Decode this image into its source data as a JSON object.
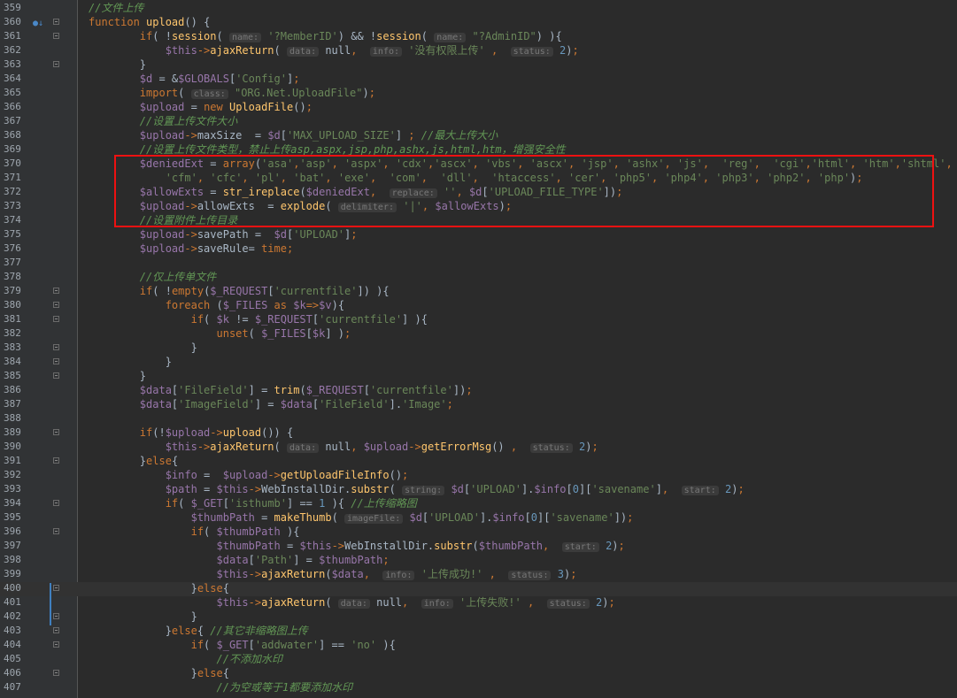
{
  "editor": {
    "language": "php",
    "colors": {
      "background": "#2b2b2b",
      "keyword": "#cc7832",
      "function": "#ffc66d",
      "variable": "#9876aa",
      "string": "#6a8759",
      "comment": "#629755",
      "highlight_box": "#ee1111"
    },
    "gutter_icons": [
      "bookmark-icon",
      "fold-icon"
    ],
    "lines": [
      {
        "n": "359",
        "t": "    //文件上传"
      },
      {
        "n": "360",
        "t": "    function upload() {"
      },
      {
        "n": "361",
        "t": "            if( !session( name: '?MemberID') && !session( name: \"?AdminID\") ){"
      },
      {
        "n": "362",
        "t": "                $this->ajaxReturn( data: null,  info: '没有权限上传' ,  status: 2);"
      },
      {
        "n": "363",
        "t": "            }"
      },
      {
        "n": "364",
        "t": "            $d = &$GLOBALS['Config'];"
      },
      {
        "n": "365",
        "t": "            import( class: \"ORG.Net.UploadFile\");"
      },
      {
        "n": "366",
        "t": "            $upload = new UploadFile();"
      },
      {
        "n": "367",
        "t": "            //设置上传文件大小"
      },
      {
        "n": "368",
        "t": "            $upload->maxSize  = $d['MAX_UPLOAD_SIZE'] ; //最大上传大小"
      },
      {
        "n": "369",
        "t": "            //设置上传文件类型，禁止上传asp,aspx,jsp,php,ashx,js,html,htm，增强安全性"
      },
      {
        "n": "370",
        "t": "            $deniedExt = array('asa','asp', 'aspx', 'cdx','ascx', 'vbs', 'ascx', 'jsp', 'ashx', 'js',  'reg',  'cgi','html', 'htm','shtml',"
      },
      {
        "n": "371",
        "t": "                'cfm', 'cfc', 'pl', 'bat', 'exe',  'com',  'dll',  'htaccess', 'cer', 'php5', 'php4', 'php3', 'php2', 'php');"
      },
      {
        "n": "372",
        "t": "            $allowExts = str_ireplace($deniedExt,  replace: '', $d['UPLOAD_FILE_TYPE']);"
      },
      {
        "n": "373",
        "t": "            $upload->allowExts  = explode( delimiter: '|', $allowExts);"
      },
      {
        "n": "374",
        "t": "            //设置附件上传目录"
      },
      {
        "n": "375",
        "t": "            $upload->savePath =  $d['UPLOAD'];"
      },
      {
        "n": "376",
        "t": "            $upload->saveRule= time;"
      },
      {
        "n": "377",
        "t": ""
      },
      {
        "n": "378",
        "t": "            //仅上传单文件"
      },
      {
        "n": "379",
        "t": "            if( !empty($_REQUEST['currentfile']) ){"
      },
      {
        "n": "380",
        "t": "                foreach ($_FILES as $k=>$v){"
      },
      {
        "n": "381",
        "t": "                    if( $k != $_REQUEST['currentfile'] ){"
      },
      {
        "n": "382",
        "t": "                        unset( $_FILES[$k] );"
      },
      {
        "n": "383",
        "t": "                    }"
      },
      {
        "n": "384",
        "t": "                }"
      },
      {
        "n": "385",
        "t": "            }"
      },
      {
        "n": "386",
        "t": "            $data['FileField'] = trim($_REQUEST['currentfile']);"
      },
      {
        "n": "387",
        "t": "            $data['ImageField'] = $data['FileField'].'Image';"
      },
      {
        "n": "388",
        "t": ""
      },
      {
        "n": "389",
        "t": "            if(!$upload->upload()) {"
      },
      {
        "n": "390",
        "t": "                $this->ajaxReturn( data: null, $upload->getErrorMsg() ,  status: 2);"
      },
      {
        "n": "391",
        "t": "            }else{"
      },
      {
        "n": "392",
        "t": "                $info =  $upload->getUploadFileInfo();"
      },
      {
        "n": "393",
        "t": "                $path = $this->WebInstallDir.substr( string: $d['UPLOAD'].$info[0]['savename'],  start: 2);"
      },
      {
        "n": "394",
        "t": "                if( $_GET['isthumb'] == 1 ){ //上传缩略图"
      },
      {
        "n": "395",
        "t": "                    $thumbPath = makeThumb( imageFile: $d['UPLOAD'].$info[0]['savename']);"
      },
      {
        "n": "396",
        "t": "                    if( $thumbPath ){"
      },
      {
        "n": "397",
        "t": "                        $thumbPath = $this->WebInstallDir.substr($thumbPath,  start: 2);"
      },
      {
        "n": "398",
        "t": "                        $data['Path'] = $thumbPath;"
      },
      {
        "n": "399",
        "t": "                        $this->ajaxReturn($data,  info: '上传成功!' ,  status: 3);"
      },
      {
        "n": "400",
        "t": "                    }else{"
      },
      {
        "n": "401",
        "t": "                        $this->ajaxReturn( data: null,  info: '上传失败!' ,  status: 2);"
      },
      {
        "n": "402",
        "t": "                    }"
      },
      {
        "n": "403",
        "t": "                }else{ //其它非缩略图上传"
      },
      {
        "n": "404",
        "t": "                    if( $_GET['addwater'] == 'no' ){"
      },
      {
        "n": "405",
        "t": "                        //不添加水印"
      },
      {
        "n": "406",
        "t": "                    }else{"
      },
      {
        "n": "407",
        "t": "                        //为空或等于1都要添加水印"
      }
    ]
  }
}
